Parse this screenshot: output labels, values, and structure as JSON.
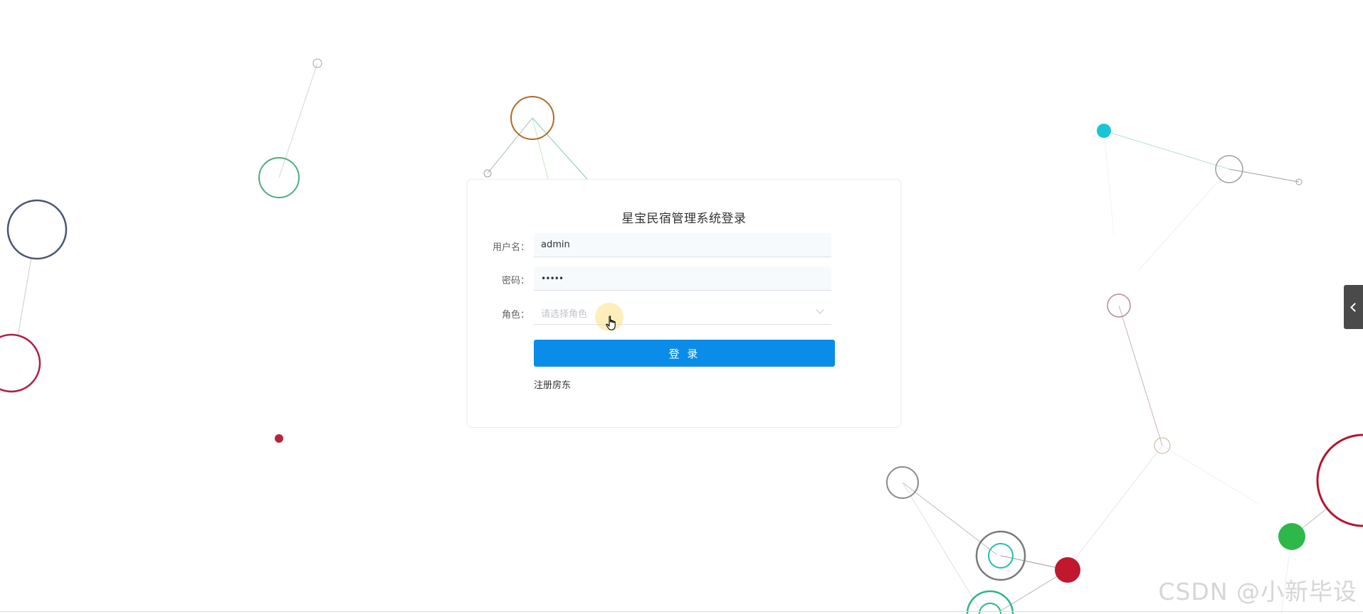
{
  "login": {
    "title": "星宝民宿管理系统登录",
    "username_label": "用户名：",
    "username_value": "admin",
    "password_label": "密码：",
    "password_value": "•••••",
    "role_label": "角色：",
    "role_placeholder": "请选择角色",
    "submit_label": "登 录",
    "register_link": "注册房东"
  },
  "colors": {
    "primary_button": "#0a8ce9",
    "input_background": "#f7fafc"
  },
  "watermark": "CSDN @小新毕设",
  "icons": {
    "side_tab": "chevron-left-icon",
    "cursor": "hand-pointer-icon",
    "role_select": "chevron-down-icon"
  }
}
